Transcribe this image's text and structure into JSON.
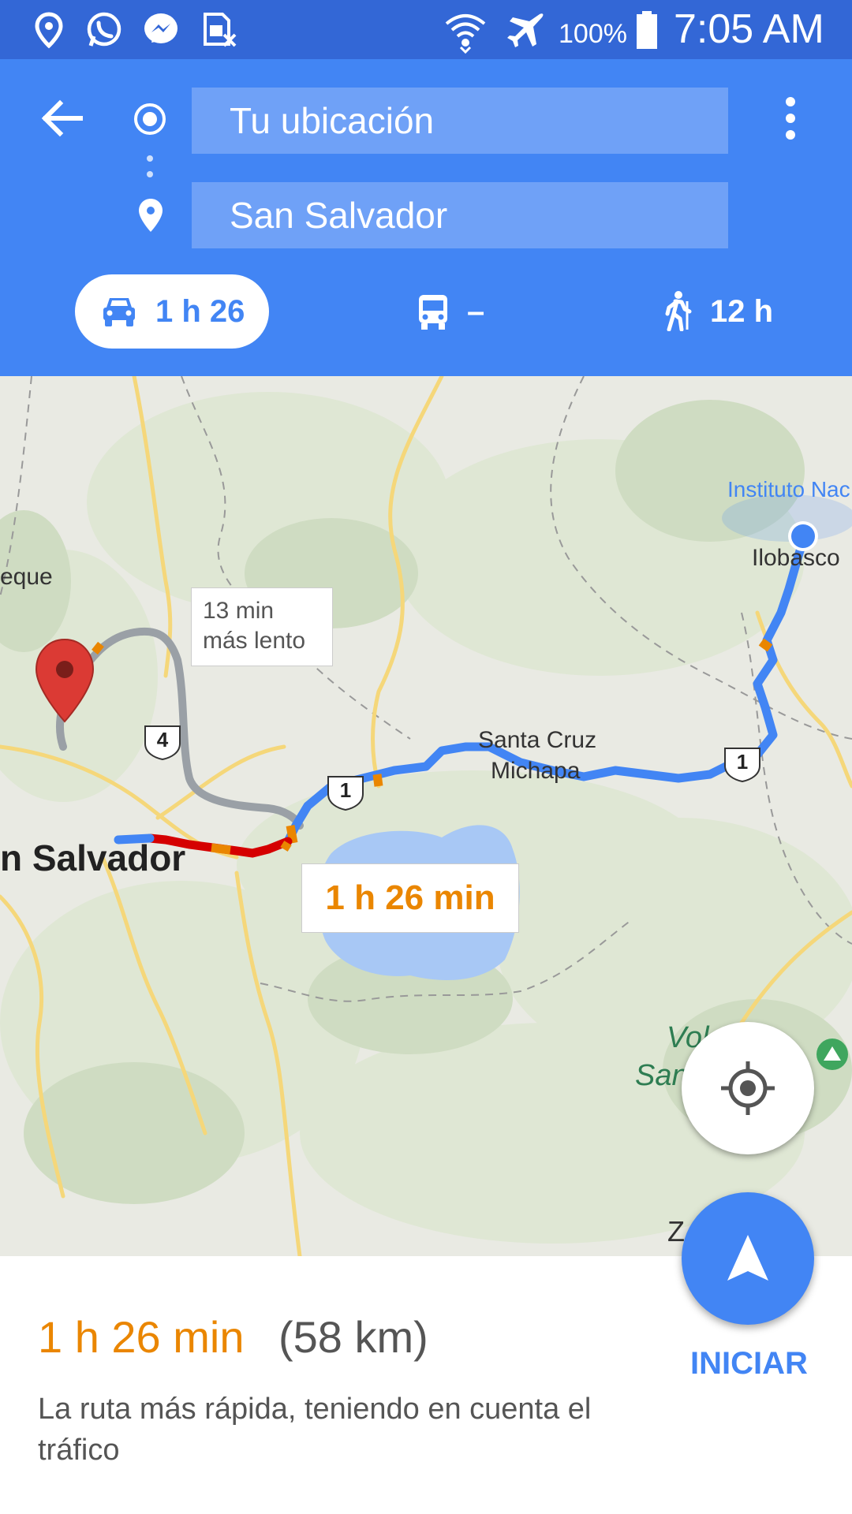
{
  "status_bar": {
    "battery": "100%",
    "time": "7:05 AM",
    "left_icons": [
      "location-pin-icon",
      "whatsapp-icon",
      "messenger-icon",
      "sim-icon"
    ],
    "right_icons": [
      "wifi-icon",
      "airplane-icon",
      "battery-icon"
    ]
  },
  "directions": {
    "origin": "Tu ubicación",
    "destination": "San Salvador",
    "modes": [
      {
        "name": "car",
        "icon": "car-icon",
        "value": "1 h 26",
        "selected": true
      },
      {
        "name": "transit",
        "icon": "bus-icon",
        "value": "–",
        "selected": false
      },
      {
        "name": "walk",
        "icon": "walk-icon",
        "value": "12 h",
        "selected": false
      }
    ]
  },
  "map": {
    "labels": {
      "instituto": "Instituto Nac",
      "ilobasco": "Ilobasco",
      "eque": "eque",
      "santa_cruz": "Santa Cruz",
      "michapa": "Michapa",
      "san_salvador": "n Salvador",
      "volcan_1": "Vol    de",
      "volcan_2": "San",
      "z_city": "Z          luca"
    },
    "alt_route": {
      "line1": "13 min",
      "line2": "más lento"
    },
    "main_route": "1 h 26 min",
    "shields": {
      "route_4": "4",
      "route_1a": "1",
      "route_1b": "1"
    }
  },
  "summary": {
    "time": "1 h 26 min",
    "distance": "(58 km)",
    "description": "La ruta más rápida, teniendo en cuenta el tráfico",
    "start_label": "INICIAR"
  },
  "colors": {
    "header": "#4285f4",
    "status_bar": "#3367d6",
    "route": "#4285f4",
    "traffic_orange": "#ea8600",
    "traffic_red": "#d50000"
  }
}
